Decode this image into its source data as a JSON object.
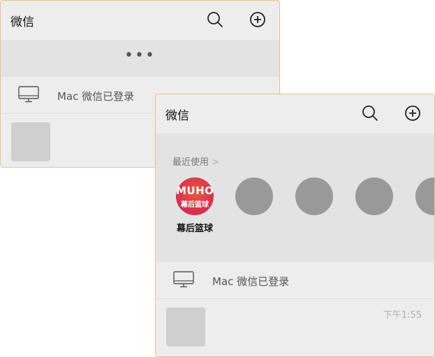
{
  "back_window": {
    "title": "微信",
    "more_label": "•••",
    "device_label": "Mac 微信已登录"
  },
  "front_window": {
    "title": "微信",
    "recent": {
      "label": "最近使用",
      "chevron": ">",
      "apps": [
        {
          "name": "幕后篮球",
          "logo_top": "MUHO",
          "logo_bottom": "幕后篮球"
        },
        {
          "name": ""
        },
        {
          "name": ""
        },
        {
          "name": ""
        },
        {
          "name": ""
        }
      ]
    },
    "device_label": "Mac 微信已登录",
    "chat_time": "下午1:55"
  },
  "icons": {
    "search": "search-icon",
    "add": "plus-circle-icon",
    "monitor": "monitor-icon"
  },
  "colors": {
    "window_border": "#e8c38a",
    "background": "#ededed",
    "logo_red": "#d9364c"
  }
}
